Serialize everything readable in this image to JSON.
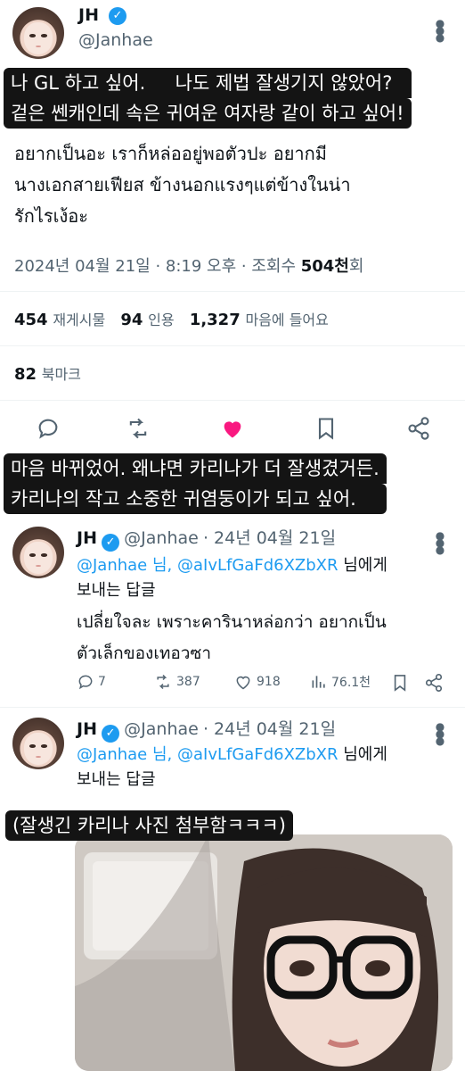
{
  "main_tweet": {
    "name": "JH",
    "handle": "@Janhae",
    "caption_lines": [
      "나 GL 하고 싶어.     나도 제법 잘생기지 않았어?",
      "겉은 쎈캐인데 속은 귀여운 여자랑 같이 하고 싶어!"
    ],
    "thai_lines": [
      "อยากเป็นอะ เราก็หล่ออยู่พอตัวปะ อยากมี",
      "นางเอกสายเฟียส ข้างนอกแรงๆแต่ข้างในน่า",
      "รักไรเง้อะ"
    ],
    "meta_prefix": "2024년 04월 21일 · 8:19 오후 · 조회수 ",
    "views": "504천",
    "views_suffix": "회",
    "stats": {
      "retweets": "454",
      "retweets_label": "재게시물",
      "quotes": "94",
      "quotes_label": "인용",
      "likes": "1,327",
      "likes_label": "마음에 들어요"
    },
    "bookmarks": "82",
    "bookmarks_label": "북마크"
  },
  "caption2_lines": [
    "마음 바뀌었어. 왜냐면 카리나가 더 잘생겼거든.",
    "카리나의 작고 소중한 귀염둥이가 되고 싶어."
  ],
  "reply1": {
    "name": "JH",
    "handle": "@Janhae",
    "date": "· 24년 04월 21일",
    "reply_to_mention1": "@Janhae 님,",
    "reply_to_mention2": "@aIvLfGaFd6XZbXR",
    "reply_to_suffix": "님에게",
    "reply_to_line2": "보내는 답글",
    "thai_lines": [
      "เปลี่ยใจละ เพราะคารินาหล่อกว่า อยากเป็น",
      "ตัวเล็กของเทอวซา"
    ],
    "counts": {
      "replies": "7",
      "retweets": "387",
      "likes": "918",
      "views": "76.1천"
    }
  },
  "reply2": {
    "name": "JH",
    "handle": "@Janhae",
    "date": "· 24년 04월 21일",
    "reply_to_mention1": "@Janhae 님,",
    "reply_to_mention2": "@aIvLfGaFd6XZbXR",
    "reply_to_suffix": "님에게",
    "reply_to_line2": "보내는 답글",
    "caption": "(잘생긴 카리나 사진 첨부함ㅋㅋㅋ)"
  },
  "icons": {
    "reply": "reply-icon",
    "retweet": "retweet-icon",
    "like": "heart-icon",
    "bookmark": "bookmark-icon",
    "share": "share-icon",
    "views": "views-icon"
  },
  "colors": {
    "like_active": "#f91880",
    "link": "#1d9bf0",
    "caption_bg": "#141414"
  }
}
